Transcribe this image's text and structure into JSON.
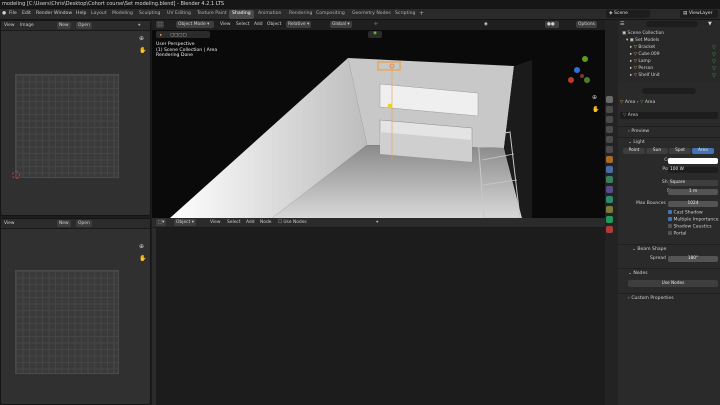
{
  "title_bar": "modeling [C:\\Users\\Chris\\Desktop\\Cohort course\\Set modeling.blend] - Blender 4.2.1 LTS",
  "menu": [
    "File",
    "Edit",
    "Render",
    "Window",
    "Help"
  ],
  "workspaces": [
    "Layout",
    "Modeling",
    "Sculpting",
    "UV Editing",
    "Texture Paint",
    "Shading",
    "Animation",
    "Rendering",
    "Compositing",
    "Geometry Nodes",
    "Scripting"
  ],
  "active_workspace": "Shading",
  "scene": "Scene",
  "view_layer": "ViewLayer",
  "image_editor_top": {
    "view": "View",
    "image": "Image",
    "new": "New",
    "open": "Open"
  },
  "image_editor_bottom": {
    "view": "View",
    "new": "New",
    "open": "Open"
  },
  "viewport": {
    "mode": "Object Mode",
    "menus": [
      "View",
      "Select",
      "Add",
      "Object"
    ],
    "gizmo": "Relative",
    "transform": "Global",
    "options": "Options",
    "overlay_lines": [
      "User Perspective",
      "(1) Scene Collection | Area",
      "Rendering Done"
    ]
  },
  "node_editor": {
    "type": "Object",
    "menus": [
      "View",
      "Select",
      "Add",
      "Node"
    ],
    "use_nodes": "Use Nodes"
  },
  "outliner": {
    "search_placeholder": "",
    "root": "Scene Collection",
    "collection": "Set Models",
    "items": [
      "Bracket",
      "Cube.009",
      "Lamp",
      "Person",
      "Shelf Unit"
    ]
  },
  "properties": {
    "breadcrumb": [
      "Area",
      "Area"
    ],
    "object_name": "Area",
    "sections": {
      "preview": "Preview",
      "light": "Light",
      "shadow": "Beam Shape",
      "nodes": "Nodes",
      "custom": "Custom Properties"
    },
    "light_types": [
      "Point",
      "Sun",
      "Spot",
      "Area"
    ],
    "color_label": "Color",
    "power_label": "Power",
    "power_value": "100 W",
    "shape_label": "Shape",
    "shape_value": "Square",
    "size_label": "Size",
    "size_value": "1 m",
    "max_bounces_label": "Max Bounces",
    "max_bounces_value": "1024",
    "checks": [
      "Cast Shadow",
      "Multiple Importance",
      "Shadow Caustics",
      "Portal"
    ],
    "checks_on": [
      true,
      true,
      false,
      false
    ],
    "spread_label": "Spread",
    "spread_value": "180°",
    "use_nodes": "Use Nodes"
  },
  "colors": {
    "accent": "#4772b3",
    "active_tab": "#4a4a4a",
    "light_orange": "#e8a24a"
  }
}
